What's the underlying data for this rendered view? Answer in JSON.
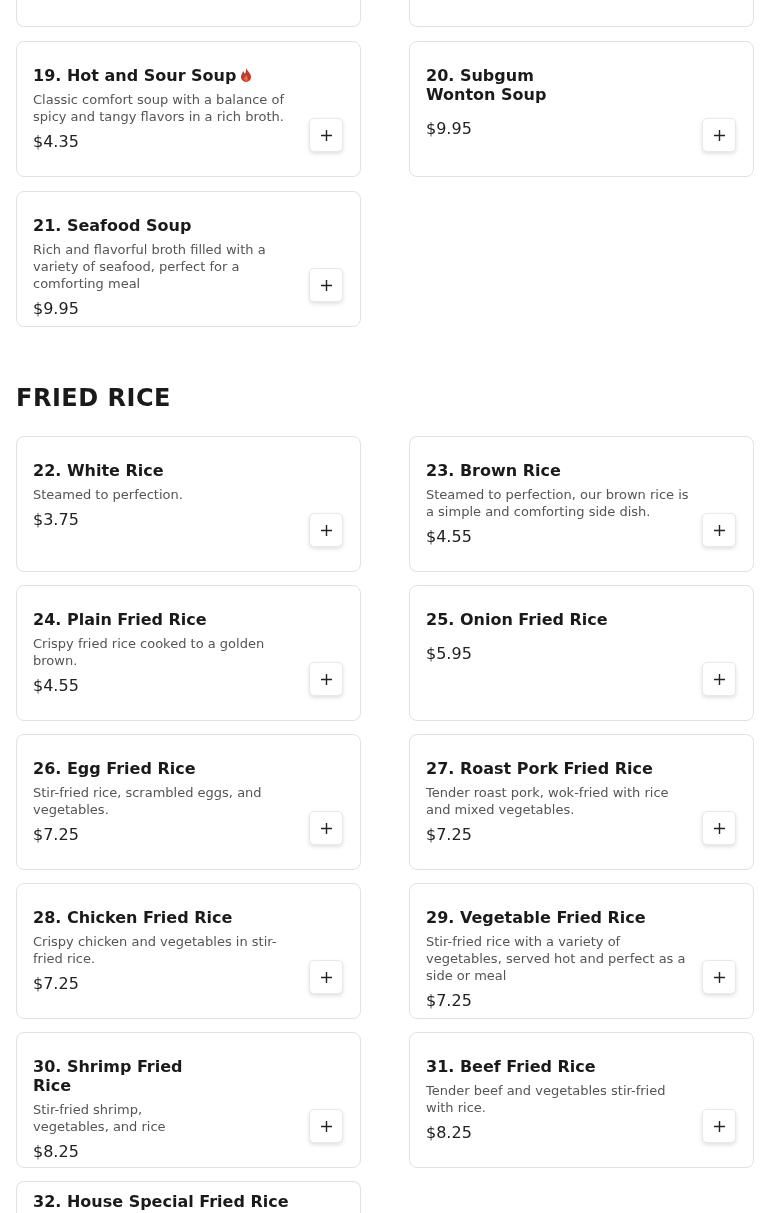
{
  "sections": [
    {
      "items": [
        {
          "kind": "cut"
        },
        {
          "kind": "cut"
        },
        {
          "kind": "standard",
          "title": "19. Hot and Sour Soup",
          "spicy": true,
          "description": "Classic comfort soup with a balance of spicy and tangy flavors in a rich broth.",
          "price": "$4.35"
        },
        {
          "kind": "narrow",
          "title": "20. Subgum Wonton Soup",
          "spicy": false,
          "price": "$9.95"
        },
        {
          "kind": "standard",
          "title": "21. Seafood Soup",
          "spicy": false,
          "description": "Rich and flavorful broth filled with a variety of seafood, perfect for a comforting meal",
          "price": "$9.95"
        }
      ]
    },
    {
      "heading": "FRIED RICE",
      "items": [
        {
          "kind": "standard",
          "title": "22. White Rice",
          "spicy": false,
          "description": "Steamed to perfection.",
          "price": "$3.75"
        },
        {
          "kind": "standard",
          "title": "23. Brown Rice",
          "spicy": false,
          "description": "Steamed to perfection, our brown rice is a simple and comforting side dish.",
          "price": "$4.55"
        },
        {
          "kind": "standard",
          "title": "24. Plain Fried Rice",
          "spicy": false,
          "description": "Crispy fried rice cooked to a golden brown.",
          "price": "$4.55"
        },
        {
          "kind": "standard",
          "title": "25. Onion Fried Rice",
          "spicy": false,
          "price": "$5.95"
        },
        {
          "kind": "standard",
          "title": "26. Egg Fried Rice",
          "spicy": false,
          "description": "Stir-fried rice, scrambled eggs, and vegetables.",
          "price": "$7.25"
        },
        {
          "kind": "standard",
          "title": "27. Roast Pork Fried Rice",
          "spicy": false,
          "description": "Tender roast pork, wok-fried with rice and mixed vegetables.",
          "price": "$7.25"
        },
        {
          "kind": "standard",
          "title": "28. Chicken Fried Rice",
          "spicy": false,
          "description": "Crispy chicken and vegetables in stir-fried rice.",
          "price": "$7.25"
        },
        {
          "kind": "standard",
          "title": "29. Vegetable Fried Rice",
          "spicy": false,
          "description": "Stir-fried rice with a variety of vegetables, served hot and perfect as a side or meal",
          "price": "$7.25"
        },
        {
          "kind": "narrow",
          "title": "30. Shrimp Fried Rice",
          "spicy": false,
          "description": "Stir-fried shrimp, vegetables, and rice",
          "price": "$8.25"
        },
        {
          "kind": "standard",
          "title": "31. Beef Fried Rice",
          "spicy": false,
          "description": "Tender beef and vegetables stir-fried with rice.",
          "price": "$8.25"
        },
        {
          "kind": "partial",
          "title": "32. House Special Fried Rice",
          "spicy": false
        }
      ]
    }
  ]
}
